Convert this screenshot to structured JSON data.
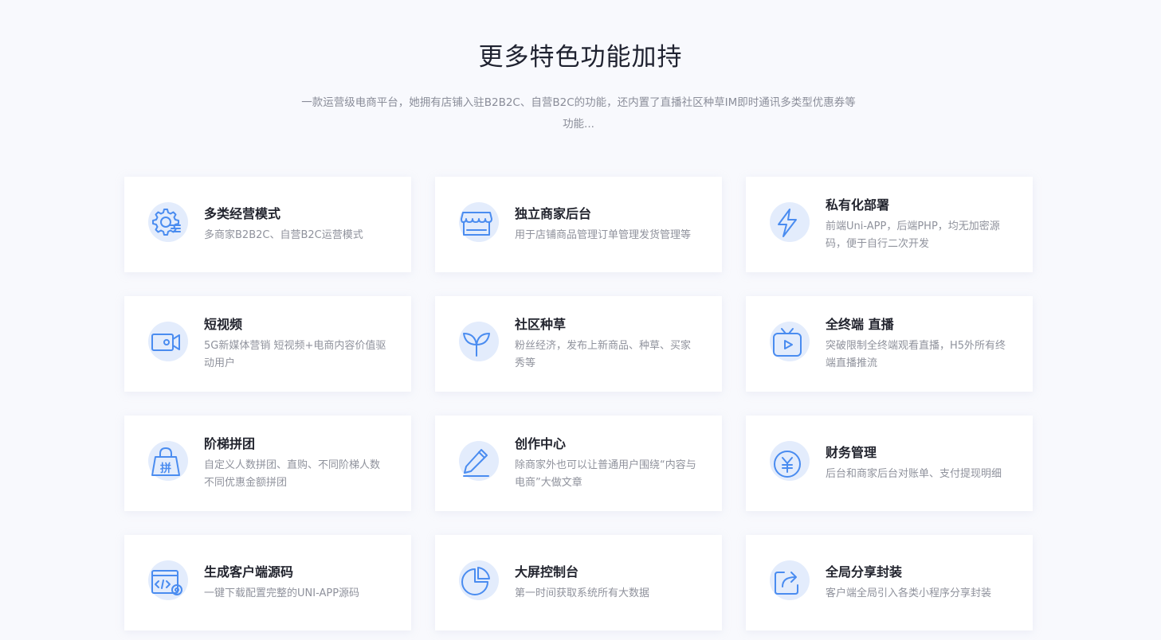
{
  "header": {
    "title": "更多特色功能加持",
    "subtitle": "一款运营级电商平台，她拥有店铺入驻B2B2C、自营B2C的功能，还内置了直播社区种草IM即时通讯多类型优惠券等功能..."
  },
  "features": [
    {
      "title": "多类经营模式",
      "desc": "多商家B2B2C、自营B2C运营模式",
      "icon": "gear-settings-icon"
    },
    {
      "title": "独立商家后台",
      "desc": "用于店铺商品管理订单管理发货管理等",
      "icon": "storefront-icon"
    },
    {
      "title": "私有化部署",
      "desc": "前端Uni-APP，后端PHP，均无加密源码，便于自行二次开发",
      "icon": "lightning-icon"
    },
    {
      "title": "短视频",
      "desc": "5G新媒体营销 短视频+电商内容价值驱动用户",
      "icon": "video-camera-icon"
    },
    {
      "title": "社区种草",
      "desc": "粉丝经济，发布上新商品、种草、买家秀等",
      "icon": "sprout-icon"
    },
    {
      "title": "全终端 直播",
      "desc": "突破限制全终端观看直播，H5外所有终端直播推流",
      "icon": "tv-play-icon"
    },
    {
      "title": "阶梯拼团",
      "desc": "自定义人数拼团、直购、不同阶梯人数不同优惠金额拼团",
      "icon": "group-buy-bag-icon"
    },
    {
      "title": "创作中心",
      "desc": "除商家外也可以让普通用户围绕“内容与电商”大做文章",
      "icon": "pen-icon"
    },
    {
      "title": "财务管理",
      "desc": "后台和商家后台对账单、支付提现明细",
      "icon": "yuan-coin-icon"
    },
    {
      "title": "生成客户端源码",
      "desc": "一键下载配置完整的UNI-APP源码",
      "icon": "code-window-icon"
    },
    {
      "title": "大屏控制台",
      "desc": "第一时间获取系统所有大数据",
      "icon": "pie-chart-icon"
    },
    {
      "title": "全局分享封装",
      "desc": "客户端全局引入各类小程序分享封装",
      "icon": "share-icon"
    }
  ],
  "colors": {
    "accent": "#4a8cf0",
    "icon_bg": "#e3ecfc",
    "page_bg": "#f8f9fd"
  }
}
